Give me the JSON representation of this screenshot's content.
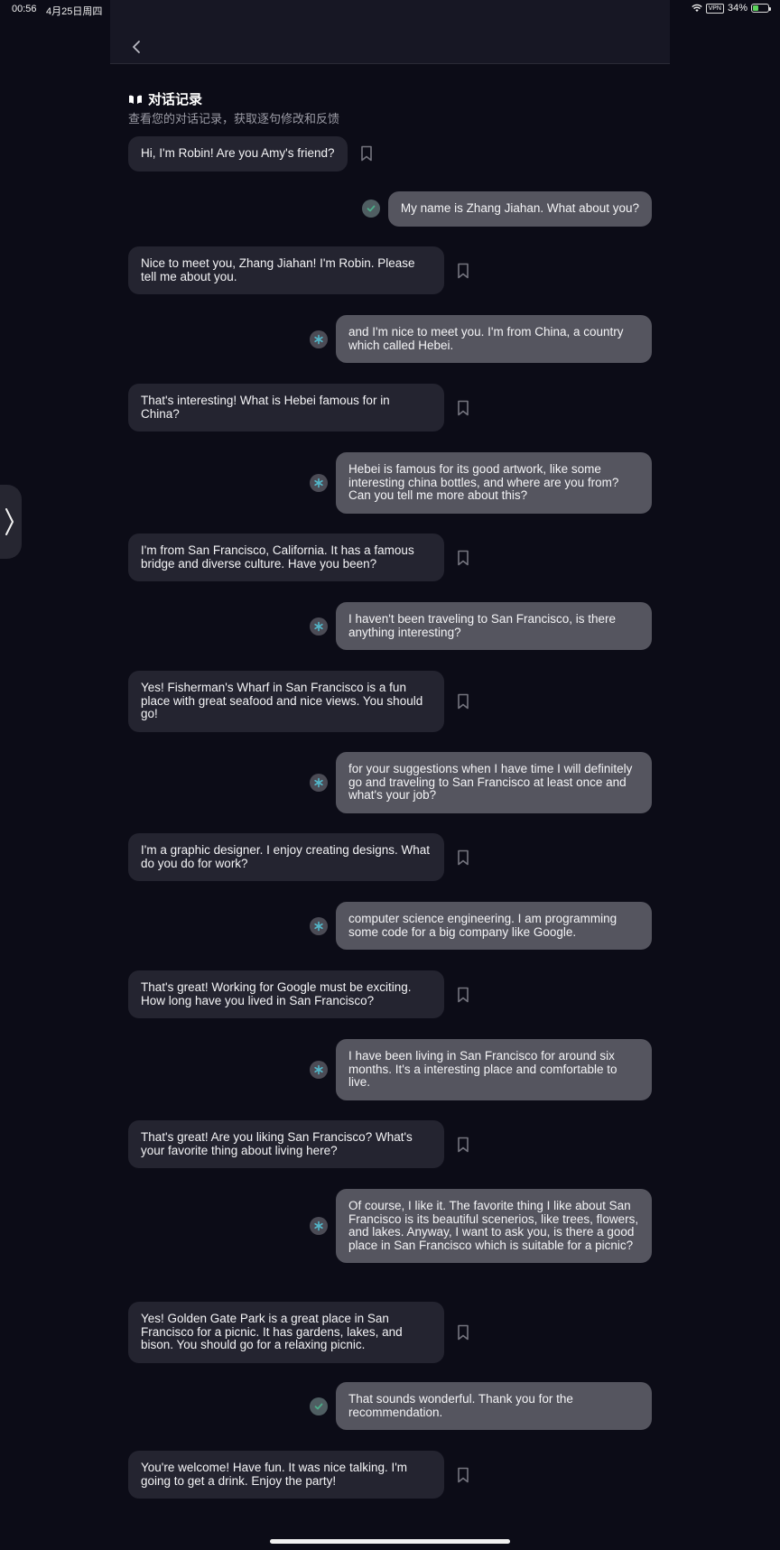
{
  "status_bar": {
    "time": "00:56",
    "date": "4月25日周四",
    "vpn": "VPN",
    "battery": "34%"
  },
  "header": {
    "title": "对话记录",
    "subtitle": "查看您的对话记录，获取逐句修改和反馈"
  },
  "colors": {
    "background": "#0c0c17",
    "ai_bubble": "#242430",
    "user_bubble": "#55555f",
    "accent_teal": "#53b7c9",
    "check_green": "#4caf8a"
  },
  "messages": [
    {
      "role": "ai",
      "text": "Hi, I'm Robin! Are you Amy's friend?"
    },
    {
      "role": "user",
      "status": "correct",
      "text": "My name is Zhang Jiahan. What about you?"
    },
    {
      "role": "ai",
      "text": "Nice to meet you, Zhang Jiahan! I'm Robin. Please tell me about you."
    },
    {
      "role": "user",
      "status": "feedback",
      "text": "and I'm nice to meet you. I'm from China, a country which called Hebei."
    },
    {
      "role": "ai",
      "text": "That's interesting! What is Hebei famous for in China?"
    },
    {
      "role": "user",
      "status": "feedback",
      "text": "Hebei is famous for its good artwork, like some interesting china bottles, and where are you from? Can you tell me more about this?"
    },
    {
      "role": "ai",
      "text": "I'm from San Francisco, California. It has a famous bridge and diverse culture. Have you been?"
    },
    {
      "role": "user",
      "status": "feedback",
      "text": "I haven't been traveling to San Francisco, is there anything interesting?"
    },
    {
      "role": "ai",
      "text": "Yes! Fisherman's Wharf in San Francisco is a fun place with great seafood and nice views. You should go!"
    },
    {
      "role": "user",
      "status": "feedback",
      "text": "for your suggestions when I have time I will definitely go and traveling to San Francisco at least once and what's your job?"
    },
    {
      "role": "ai",
      "text": "I'm a graphic designer. I enjoy creating designs. What do you do for work?"
    },
    {
      "role": "user",
      "status": "feedback",
      "text": "computer science engineering. I am programming some code for a big company like Google."
    },
    {
      "role": "ai",
      "text": "That's great! Working for Google must be exciting. How long have you lived in San Francisco?"
    },
    {
      "role": "user",
      "status": "feedback",
      "text": "I have been living in San Francisco for around six months. It's a interesting place and comfortable to live."
    },
    {
      "role": "ai",
      "text": "That's great! Are you liking San Francisco? What's your favorite thing about living here?"
    },
    {
      "role": "user",
      "status": "feedback",
      "text": "Of course, I like it. The favorite thing I like about San Francisco is its beautiful scenerios, like trees, flowers, and lakes. Anyway, I want to ask you, is there a good place in San Francisco which is suitable for a picnic?"
    },
    {
      "role": "ai",
      "text": "Yes! Golden Gate Park is a great place in San Francisco for a picnic. It has gardens, lakes, and bison. You should go for a relaxing picnic."
    },
    {
      "role": "user",
      "status": "correct",
      "text": "That sounds wonderful. Thank you for the recommendation."
    },
    {
      "role": "ai",
      "text": "You're welcome! Have fun. It was nice talking. I'm going to get a drink. Enjoy the party!"
    }
  ]
}
